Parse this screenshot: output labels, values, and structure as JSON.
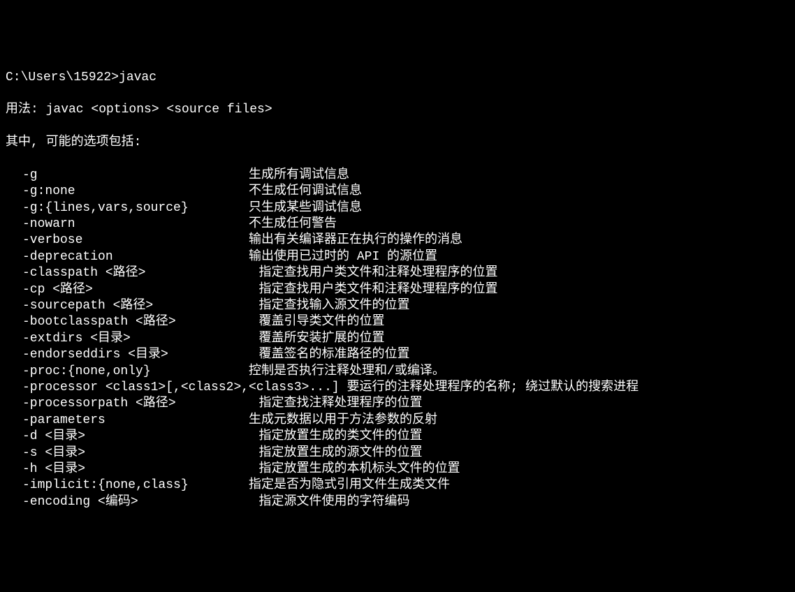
{
  "prompt": "C:\\Users\\15922>javac",
  "usage": "用法: javac <options> <source files>",
  "subheader": "其中, 可能的选项包括:",
  "options": [
    {
      "flag": "-g",
      "desc": "生成所有调试信息",
      "pad": 30
    },
    {
      "flag": "-g:none",
      "desc": "不生成任何调试信息",
      "pad": 30
    },
    {
      "flag": "-g:{lines,vars,source}",
      "desc": "只生成某些调试信息",
      "pad": 30
    },
    {
      "flag": "-nowarn",
      "desc": "不生成任何警告",
      "pad": 30
    },
    {
      "flag": "-verbose",
      "desc": "输出有关编译器正在执行的操作的消息",
      "pad": 30
    },
    {
      "flag": "-deprecation",
      "desc": "输出使用已过时的 API 的源位置",
      "pad": 30
    },
    {
      "flag": "-classpath <路径>",
      "desc": "指定查找用户类文件和注释处理程序的位置",
      "pad": 32
    },
    {
      "flag": "-cp <路径>",
      "desc": "指定查找用户类文件和注释处理程序的位置",
      "pad": 32
    },
    {
      "flag": "-sourcepath <路径>",
      "desc": "指定查找输入源文件的位置",
      "pad": 32
    },
    {
      "flag": "-bootclasspath <路径>",
      "desc": "覆盖引导类文件的位置",
      "pad": 32
    },
    {
      "flag": "-extdirs <目录>",
      "desc": "覆盖所安装扩展的位置",
      "pad": 32
    },
    {
      "flag": "-endorseddirs <目录>",
      "desc": "覆盖签名的标准路径的位置",
      "pad": 32
    },
    {
      "flag": "-proc:{none,only}",
      "desc": "控制是否执行注释处理和/或编译。",
      "pad": 30
    },
    {
      "flag": "-processor <class1>[,<class2>,<class3>...] 要运行的注释处理程序的名称; 绕过默认的搜索进程",
      "desc": "",
      "pad": 0
    },
    {
      "flag": "-processorpath <路径>",
      "desc": "指定查找注释处理程序的位置",
      "pad": 32
    },
    {
      "flag": "-parameters",
      "desc": "生成元数据以用于方法参数的反射",
      "pad": 30
    },
    {
      "flag": "-d <目录>",
      "desc": "指定放置生成的类文件的位置",
      "pad": 32
    },
    {
      "flag": "-s <目录>",
      "desc": "指定放置生成的源文件的位置",
      "pad": 32
    },
    {
      "flag": "-h <目录>",
      "desc": "指定放置生成的本机标头文件的位置",
      "pad": 32
    },
    {
      "flag": "-implicit:{none,class}",
      "desc": "指定是否为隐式引用文件生成类文件",
      "pad": 30
    },
    {
      "flag": "-encoding <编码>",
      "desc": "指定源文件使用的字符编码",
      "pad": 32
    }
  ]
}
